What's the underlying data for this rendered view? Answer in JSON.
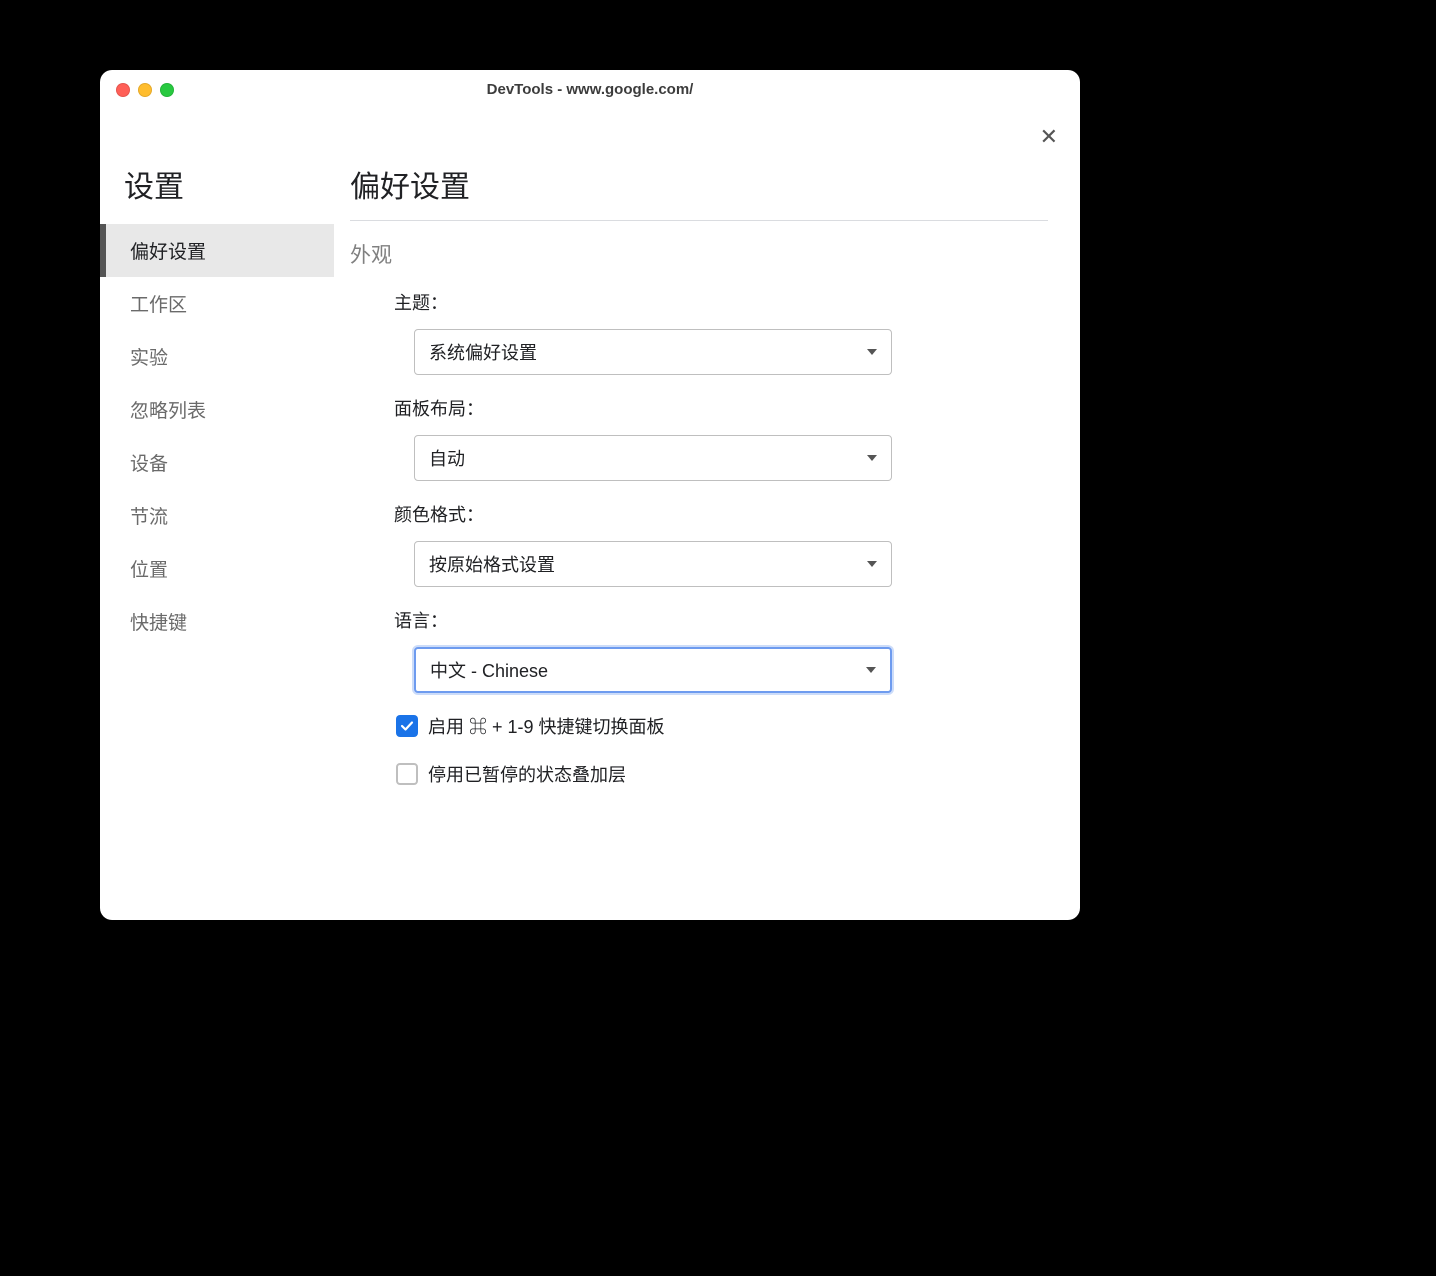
{
  "window": {
    "title": "DevTools - www.google.com/"
  },
  "sidebar": {
    "title": "设置",
    "items": [
      {
        "label": "偏好设置",
        "active": true
      },
      {
        "label": "工作区",
        "active": false
      },
      {
        "label": "实验",
        "active": false
      },
      {
        "label": "忽略列表",
        "active": false
      },
      {
        "label": "设备",
        "active": false
      },
      {
        "label": "节流",
        "active": false
      },
      {
        "label": "位置",
        "active": false
      },
      {
        "label": "快捷键",
        "active": false
      }
    ]
  },
  "main": {
    "title": "偏好设置",
    "section": "外观",
    "fields": {
      "theme": {
        "label": "主题：",
        "value": "系统偏好设置"
      },
      "panel_layout": {
        "label": "面板布局：",
        "value": "自动"
      },
      "color_format": {
        "label": "颜色格式：",
        "value": "按原始格式设置"
      },
      "language": {
        "label": "语言：",
        "value": "中文 - Chinese"
      }
    },
    "checkboxes": {
      "shortcut_switch": {
        "label": "启用 ⌘ + 1-9 快捷键切换面板",
        "checked": true
      },
      "disable_overlay": {
        "label": "停用已暂停的状态叠加层",
        "checked": false
      }
    }
  }
}
